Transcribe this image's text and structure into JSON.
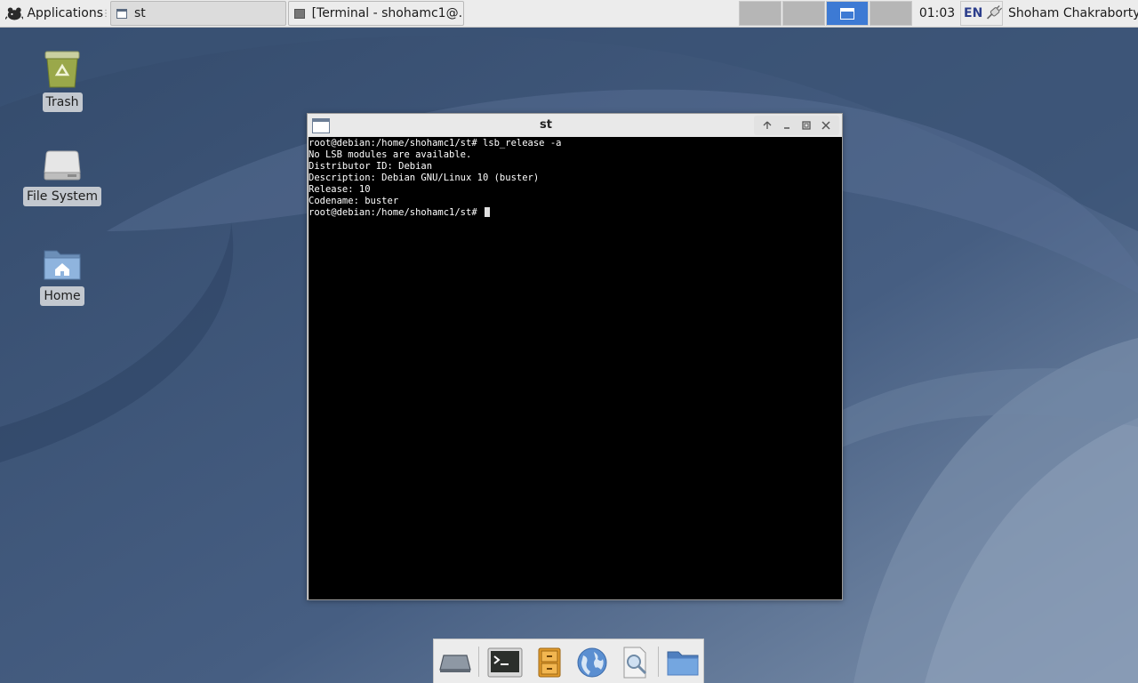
{
  "top_panel": {
    "applications_label": "Applications",
    "tasks": [
      {
        "label": "st",
        "icon": "window-icon",
        "active": true
      },
      {
        "label": "[Terminal - shohamc1@...",
        "icon": "terminal-icon",
        "active": false
      }
    ],
    "workspaces": [
      {
        "name": "workspace-1",
        "active": false
      },
      {
        "name": "workspace-2",
        "active": false
      },
      {
        "name": "workspace-3",
        "active": true
      },
      {
        "name": "workspace-4",
        "active": false
      }
    ],
    "clock": "01:03",
    "keyboard_layout": "EN",
    "user_name": "Shoham Chakraborty"
  },
  "desktop_icons": [
    {
      "label": "Trash",
      "icon": "trash-icon"
    },
    {
      "label": "File System",
      "icon": "drive-icon"
    },
    {
      "label": "Home",
      "icon": "home-folder-icon"
    }
  ],
  "window": {
    "title": "st",
    "terminal_lines": [
      "root@debian:/home/shohamc1/st# lsb_release -a",
      "No LSB modules are available.",
      "Distributor ID: Debian",
      "Description: Debian GNU/Linux 10 (buster)",
      "Release: 10",
      "Codename: buster",
      "root@debian:/home/shohamc1/st# "
    ]
  },
  "dock": {
    "items": [
      "show-desktop-icon",
      "terminal-icon",
      "file-cabinet-icon",
      "web-browser-icon",
      "app-finder-icon",
      "folder-icon"
    ]
  },
  "colors": {
    "wallpaper": "#3f5678",
    "panel": "#ececec",
    "active_workspace": "#3d7ad4",
    "terminal_bg": "#000000",
    "terminal_fg": "#ffffff"
  }
}
